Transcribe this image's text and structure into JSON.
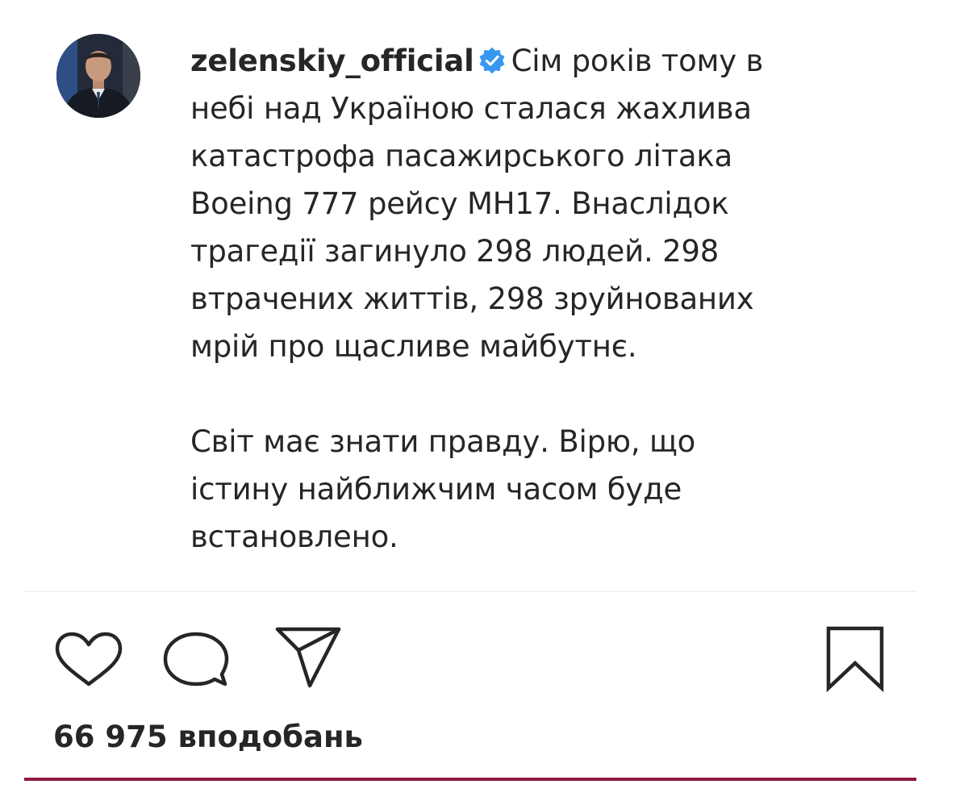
{
  "post": {
    "author": {
      "username": "zelenskiy_official",
      "verified": true,
      "verified_icon": "verified-badge-icon",
      "verified_color": "#3897f0"
    },
    "caption": {
      "lines": [
        "Сім років тому в",
        "небі над Україною сталася жахлива",
        "катастрофа пасажирського літака",
        "Boeing 777 рейсу МН17. Внаслідок",
        "трагедії загинуло 298 людей. 298",
        "втрачених життів, 298 зруйнованих",
        "мрій про щасливе майбутнє.",
        "",
        "Світ має знати правду. Вірю, що",
        "істину найближчим часом буде",
        "встановлено."
      ]
    },
    "actions": {
      "like_icon": "heart-icon",
      "comment_icon": "comment-bubble-icon",
      "share_icon": "paper-plane-icon",
      "save_icon": "bookmark-icon"
    },
    "likes_text": "66 975 вподобань"
  },
  "colors": {
    "text": "#262626",
    "verified": "#3897f0",
    "divider": "#ebebeb",
    "accent_rule": "#8e1b3e"
  }
}
